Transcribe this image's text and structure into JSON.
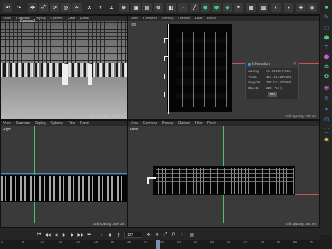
{
  "toolbar": {
    "axis_x": "X",
    "axis_y": "Y",
    "axis_z": "Z"
  },
  "viewports": {
    "perspective": {
      "menu": [
        "View",
        "Cameras",
        "Display",
        "Options",
        "Filter",
        "Panel"
      ],
      "label": "Camera.3",
      "grid_spacing": "Grid Spacing : 10000 cm"
    },
    "top": {
      "menu": [
        "View",
        "Cameras",
        "Display",
        "Options",
        "Filter",
        "Panel"
      ],
      "label": "Top",
      "grid_spacing": "Grid Spacing : 500 cm"
    },
    "right": {
      "menu": [
        "View",
        "Cameras",
        "Display",
        "Options",
        "Filter",
        "Panel"
      ],
      "label": "Right",
      "grid_spacing": "Grid Spacing : 500 cm"
    },
    "front": {
      "menu": [
        "View",
        "Cameras",
        "Display",
        "Options",
        "Filter",
        "Panel"
      ],
      "label": "Front",
      "grid_spacing": "Grid Spacing : 500 cm"
    }
  },
  "info_dialog": {
    "title": "Information",
    "rows": [
      {
        "label": "Memory:",
        "value": "ca. 44 942 Kbytes"
      },
      {
        "label": "Points:",
        "value": "119 180 ( 878 153 )"
      },
      {
        "label": "Polygons:",
        "value": "157 441 ( 920 641 )"
      },
      {
        "label": "Objects:",
        "value": "220 ( 734 )"
      }
    ],
    "ok_label": "OK"
  },
  "timeline": {
    "current_frame": "127",
    "ticks": [
      "0",
      "5",
      "10",
      "15",
      "20",
      "25",
      "30",
      "35",
      "40",
      "45",
      "50",
      "55",
      "60",
      "65",
      "70",
      "75",
      "80",
      "85",
      "90"
    ]
  },
  "colors": {
    "accent_green": "#3fd27a",
    "accent_blue": "#3a8fe0",
    "axis_red": "#d05050",
    "axis_green": "#50c070"
  }
}
